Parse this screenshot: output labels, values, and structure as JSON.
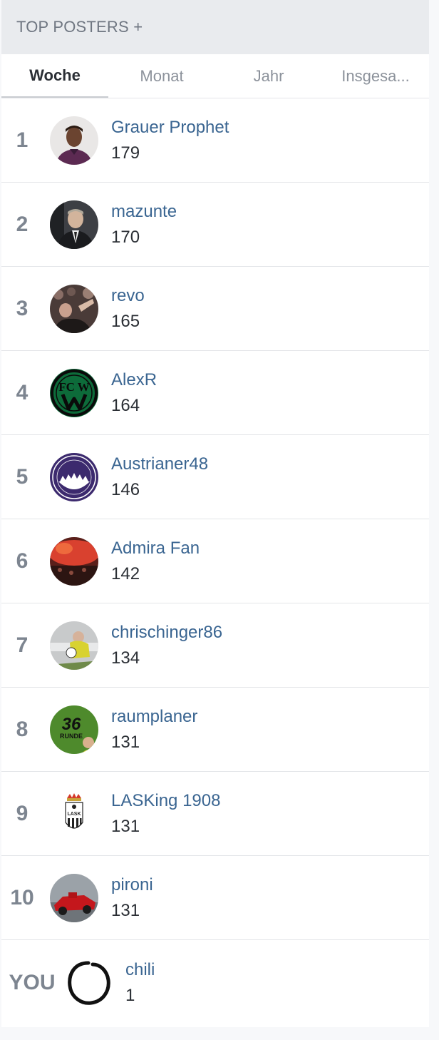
{
  "header": {
    "title": "TOP POSTERS +"
  },
  "tabs": [
    {
      "label": "Woche"
    },
    {
      "label": "Monat"
    },
    {
      "label": "Jahr"
    },
    {
      "label": "Insgesa..."
    }
  ],
  "rows": [
    {
      "rank": "1",
      "name": "Grauer Prophet",
      "count": "179"
    },
    {
      "rank": "2",
      "name": "mazunte",
      "count": "170"
    },
    {
      "rank": "3",
      "name": "revo",
      "count": "165"
    },
    {
      "rank": "4",
      "name": "AlexR",
      "count": "164"
    },
    {
      "rank": "5",
      "name": "Austrianer48",
      "count": "146"
    },
    {
      "rank": "6",
      "name": "Admira Fan",
      "count": "142"
    },
    {
      "rank": "7",
      "name": "chrischinger86",
      "count": "134"
    },
    {
      "rank": "8",
      "name": "raumplaner",
      "count": "131"
    },
    {
      "rank": "9",
      "name": "LASKing 1908",
      "count": "131"
    },
    {
      "rank": "10",
      "name": "pironi",
      "count": "131"
    }
  ],
  "you": {
    "rank": "YOU",
    "name": "chili",
    "count": "1"
  },
  "logos": {
    "fcw": "FC W",
    "badge36": "36",
    "runde": "RUNDE",
    "lask": "LASK"
  },
  "colors": {
    "link": "#3a6591",
    "rank": "#7d8590",
    "header_bg": "#e9ebee",
    "active_tab": "#2b2f35"
  }
}
